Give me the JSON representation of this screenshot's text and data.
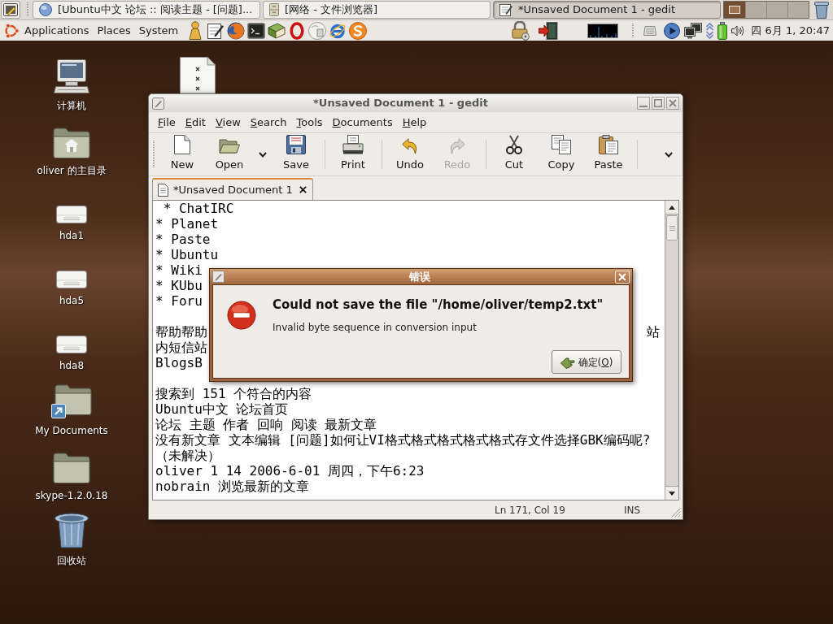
{
  "panel": {
    "tasks": [
      {
        "label": "[Ubuntu中文 论坛 :: 阅读主题 - [问题]...",
        "selected": false
      },
      {
        "label": "[网络 - 文件浏览器]",
        "selected": false
      },
      {
        "label": "*Unsaved Document 1 - gedit",
        "selected": true
      }
    ],
    "workspaces": [
      {
        "selected": true
      },
      {
        "selected": false
      },
      {
        "selected": false
      },
      {
        "selected": false
      }
    ],
    "menus": [
      "Applications",
      "Places",
      "System"
    ],
    "clock": "四 6月 1, 20:47"
  },
  "desktop_icons": [
    {
      "kind": "computer",
      "label": "计算机"
    },
    {
      "kind": "home",
      "label": "oliver 的主目录"
    },
    {
      "kind": "drive",
      "label": "hda1"
    },
    {
      "kind": "drive",
      "label": "hda5"
    },
    {
      "kind": "drive",
      "label": "hda8"
    },
    {
      "kind": "link",
      "label": "My Documents"
    },
    {
      "kind": "folder",
      "label": "skype-1.2.0.18"
    },
    {
      "kind": "trash",
      "label": "回收站"
    }
  ],
  "editor": {
    "title": "*Unsaved Document 1 - gedit",
    "menu": [
      "File",
      "Edit",
      "View",
      "Search",
      "Tools",
      "Documents",
      "Help"
    ],
    "toolbar": [
      [
        {
          "label": "New",
          "disabled": false,
          "dropdown": false
        },
        {
          "label": "Open",
          "disabled": false,
          "dropdown": true
        },
        {
          "label": "Save",
          "disabled": false,
          "dropdown": false
        }
      ],
      [
        {
          "label": "Print",
          "disabled": false,
          "dropdown": false
        }
      ],
      [
        {
          "label": "Undo",
          "disabled": false,
          "dropdown": false
        },
        {
          "label": "Redo",
          "disabled": true,
          "dropdown": false
        }
      ],
      [
        {
          "label": "Cut",
          "disabled": false,
          "dropdown": false
        },
        {
          "label": "Copy",
          "disabled": false,
          "dropdown": false
        },
        {
          "label": "Paste",
          "disabled": false,
          "dropdown": false
        }
      ]
    ],
    "tabs": [
      {
        "label": "*Unsaved Document 1",
        "selected": true
      }
    ],
    "text": [
      [
        {
          "text": " * ChatIRC"
        },
        {
          "text": "* Planet"
        },
        {
          "text": "* Paste"
        },
        {
          "text": "* Ubuntu"
        },
        {
          "text": "* Wiki"
        },
        {
          "text": "* KUbu"
        },
        {
          "text": "* Foru"
        }
      ],
      [
        {
          "text": "帮助帮助",
          "tail": "站"
        },
        {
          "text": "内短信站"
        },
        {
          "text": "BlogsB"
        }
      ],
      [
        {
          "text": "搜索到 151 个符合的内容"
        },
        {
          "text": "Ubuntu中文 论坛首页"
        },
        {
          "text": "论坛 主题 作者 回响 阅读 最新文章"
        },
        {
          "text": "没有新文章 文本编辑 [问题]如何让VI格式格式格式格式格式存文件选择GBK编码呢?"
        },
        {
          "text": "（未解决）"
        },
        {
          "text": "oliver 1 14 2006-6-01 周四，下午6:23"
        },
        {
          "text": "nobrain 浏览最新的文章"
        }
      ]
    ],
    "status": {
      "position": "Ln 171, Col 19",
      "mode": "INS"
    }
  },
  "dialog": {
    "title": "错误",
    "heading": "Could not save the file \"/home/oliver/temp2.txt\"",
    "message": "Invalid byte sequence in conversion input",
    "buttons": [
      "确定(O)"
    ]
  }
}
